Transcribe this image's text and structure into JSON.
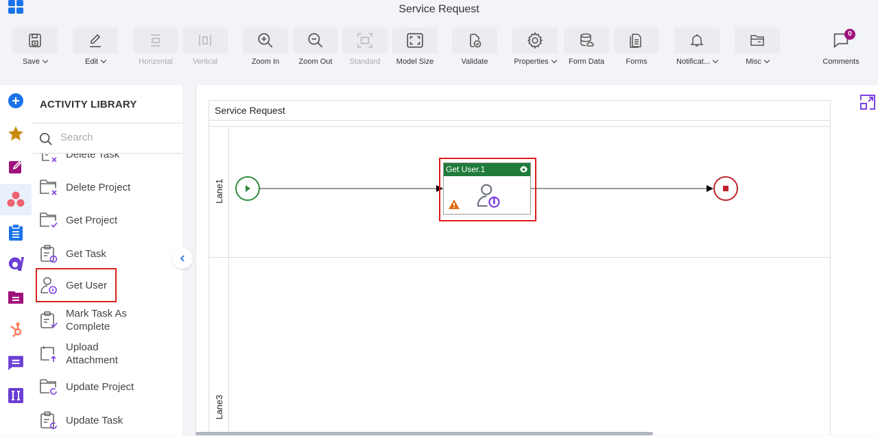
{
  "app": {
    "title": "Service Request",
    "logo_icon": "app-grid-icon"
  },
  "toolbar": {
    "items": [
      {
        "label": "Save",
        "icon": "save-icon",
        "dropdown": true,
        "disabled": false
      },
      {
        "label": "Edit",
        "icon": "edit-icon",
        "dropdown": true,
        "disabled": false
      },
      {
        "label": "Horizontal",
        "icon": "horizontal-align-icon",
        "dropdown": false,
        "disabled": true
      },
      {
        "label": "Vertical",
        "icon": "vertical-align-icon",
        "dropdown": false,
        "disabled": true
      },
      {
        "label": "Zoom In",
        "icon": "zoom-in-icon",
        "dropdown": false,
        "disabled": false
      },
      {
        "label": "Zoom Out",
        "icon": "zoom-out-icon",
        "dropdown": false,
        "disabled": false
      },
      {
        "label": "Standard",
        "icon": "standard-size-icon",
        "dropdown": false,
        "disabled": true
      },
      {
        "label": "Model Size",
        "icon": "model-size-icon",
        "dropdown": false,
        "disabled": false
      },
      {
        "label": "Validate",
        "icon": "validate-icon",
        "dropdown": false,
        "disabled": false
      },
      {
        "label": "Properties",
        "icon": "gear-icon",
        "dropdown": true,
        "disabled": false
      },
      {
        "label": "Form Data",
        "icon": "form-data-icon",
        "dropdown": false,
        "disabled": false
      },
      {
        "label": "Forms",
        "icon": "forms-icon",
        "dropdown": false,
        "disabled": false
      },
      {
        "label": "Notificat...",
        "icon": "bell-icon",
        "dropdown": true,
        "disabled": false
      },
      {
        "label": "Misc",
        "icon": "folder-icon",
        "dropdown": true,
        "disabled": false
      },
      {
        "label": "Comments",
        "icon": "comment-icon",
        "dropdown": false,
        "disabled": false,
        "badge": "0"
      }
    ]
  },
  "left_rail": {
    "items": [
      {
        "name": "add",
        "icon": "plus-circle-icon",
        "color": "#1a73e8"
      },
      {
        "name": "favorites",
        "icon": "star-icon",
        "color": "#c98a0c"
      },
      {
        "name": "forms",
        "icon": "edit-square-icon",
        "color": "#a0137c"
      },
      {
        "name": "asana",
        "icon": "asana-icon",
        "color": "#f0626f",
        "active": true
      },
      {
        "name": "clipboard",
        "icon": "clipboard-icon",
        "color": "#1a73e8"
      },
      {
        "name": "appian",
        "icon": "appian-icon",
        "color": "#6b3fd4"
      },
      {
        "name": "document-folder",
        "icon": "document-folder-icon",
        "color": "#a0137c"
      },
      {
        "name": "hubspot",
        "icon": "hubspot-icon",
        "color": "#ff7a59"
      },
      {
        "name": "chat",
        "icon": "chat-icon",
        "color": "#6b3fd4"
      },
      {
        "name": "integration",
        "icon": "integration-icon",
        "color": "#6b3fd4"
      }
    ]
  },
  "library": {
    "title": "ACTIVITY LIBRARY",
    "search_placeholder": "Search",
    "items": [
      {
        "label": "Delete Task",
        "icon": "delete-task-icon"
      },
      {
        "label": "Delete Project",
        "icon": "delete-project-icon"
      },
      {
        "label": "Get Project",
        "icon": "get-project-icon"
      },
      {
        "label": "Get Task",
        "icon": "get-task-icon"
      },
      {
        "label": "Get User",
        "icon": "get-user-icon",
        "highlighted": true
      },
      {
        "label": "Mark Task As Complete",
        "icon": "mark-task-complete-icon"
      },
      {
        "label": "Upload Attachment",
        "icon": "upload-attachment-icon"
      },
      {
        "label": "Update Project",
        "icon": "update-project-icon"
      },
      {
        "label": "Update Task",
        "icon": "update-task-icon"
      }
    ]
  },
  "canvas": {
    "pool_title": "Service Request",
    "lanes": [
      {
        "label": "Lane1"
      },
      {
        "label": "Lane3"
      }
    ],
    "start_event": {
      "icon": "play-icon",
      "color": "#2e8b3e"
    },
    "task": {
      "title": "Get User.1",
      "header_color": "#1e7b3a",
      "icon": "get-user-icon",
      "warning": true,
      "selected": true
    },
    "end_event": {
      "icon": "stop-icon",
      "color": "#c0202a"
    }
  },
  "colors": {
    "accent": "#1a73e8",
    "highlight": "#e0191d",
    "purple": "#7b3fe4"
  }
}
